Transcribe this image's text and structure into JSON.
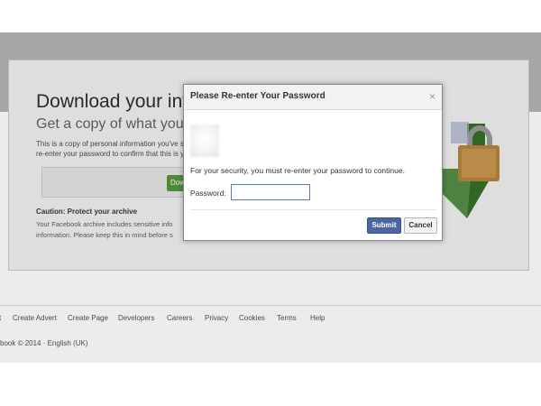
{
  "page": {
    "heading": "Download your inform",
    "subheading": "Get a copy of what you've sh",
    "description": [
      "This is a copy of personal information you've s",
      "re-enter your password to confirm that this is y"
    ],
    "download_button": "Dow",
    "caution_title": "Caution: Protect your archive",
    "caution_lines": [
      "Your Facebook archive includes sensitive info",
      "information. Please keep this in mind before s"
    ]
  },
  "footer": {
    "links": [
      "t",
      "Create Advert",
      "Create Page",
      "Developers",
      "Careers",
      "Privacy",
      "Cookies",
      "Terms",
      "Help"
    ],
    "copyright": "book © 2014 · English (UK)"
  },
  "modal": {
    "title": "Please Re-enter Your Password",
    "close_glyph": "×",
    "user_name": "",
    "security_message": "For your security, you must re-enter your password to continue.",
    "password_label": "Password:",
    "password_value": "",
    "submit_label": "Submit",
    "cancel_label": "Cancel"
  },
  "colors": {
    "submit": "#4c66a4",
    "download": "#4f8a3b",
    "input_border": "#5b7bb3"
  }
}
